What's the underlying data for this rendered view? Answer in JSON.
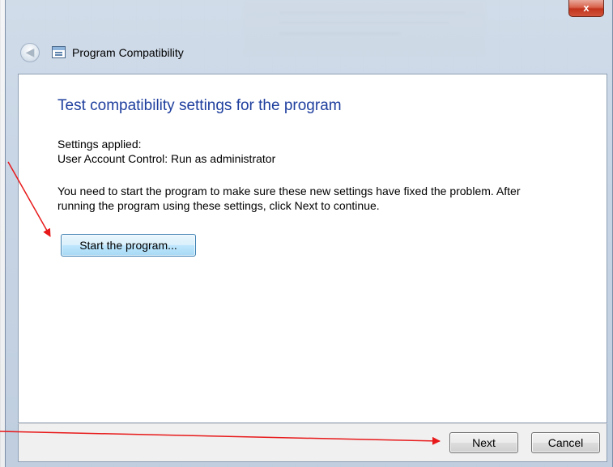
{
  "window": {
    "title": "Program Compatibility",
    "close_glyph": "x",
    "back_glyph": "◀",
    "icon": "program-compatibility-icon"
  },
  "content": {
    "heading": "Test compatibility settings for the program",
    "settings_label": "Settings applied:",
    "settings_value": "User Account Control:  Run as administrator",
    "instructions_line1": "You need to start the program to make sure these new settings have fixed the problem. After",
    "instructions_line2": "running the program using these settings, click Next to continue.",
    "start_button": "Start the program..."
  },
  "footer": {
    "next": "Next",
    "cancel": "Cancel"
  },
  "annotation": {
    "arrow_color": "#e8191a"
  },
  "colors": {
    "heading": "#1f3f9e",
    "close_button": "#c2351d"
  }
}
